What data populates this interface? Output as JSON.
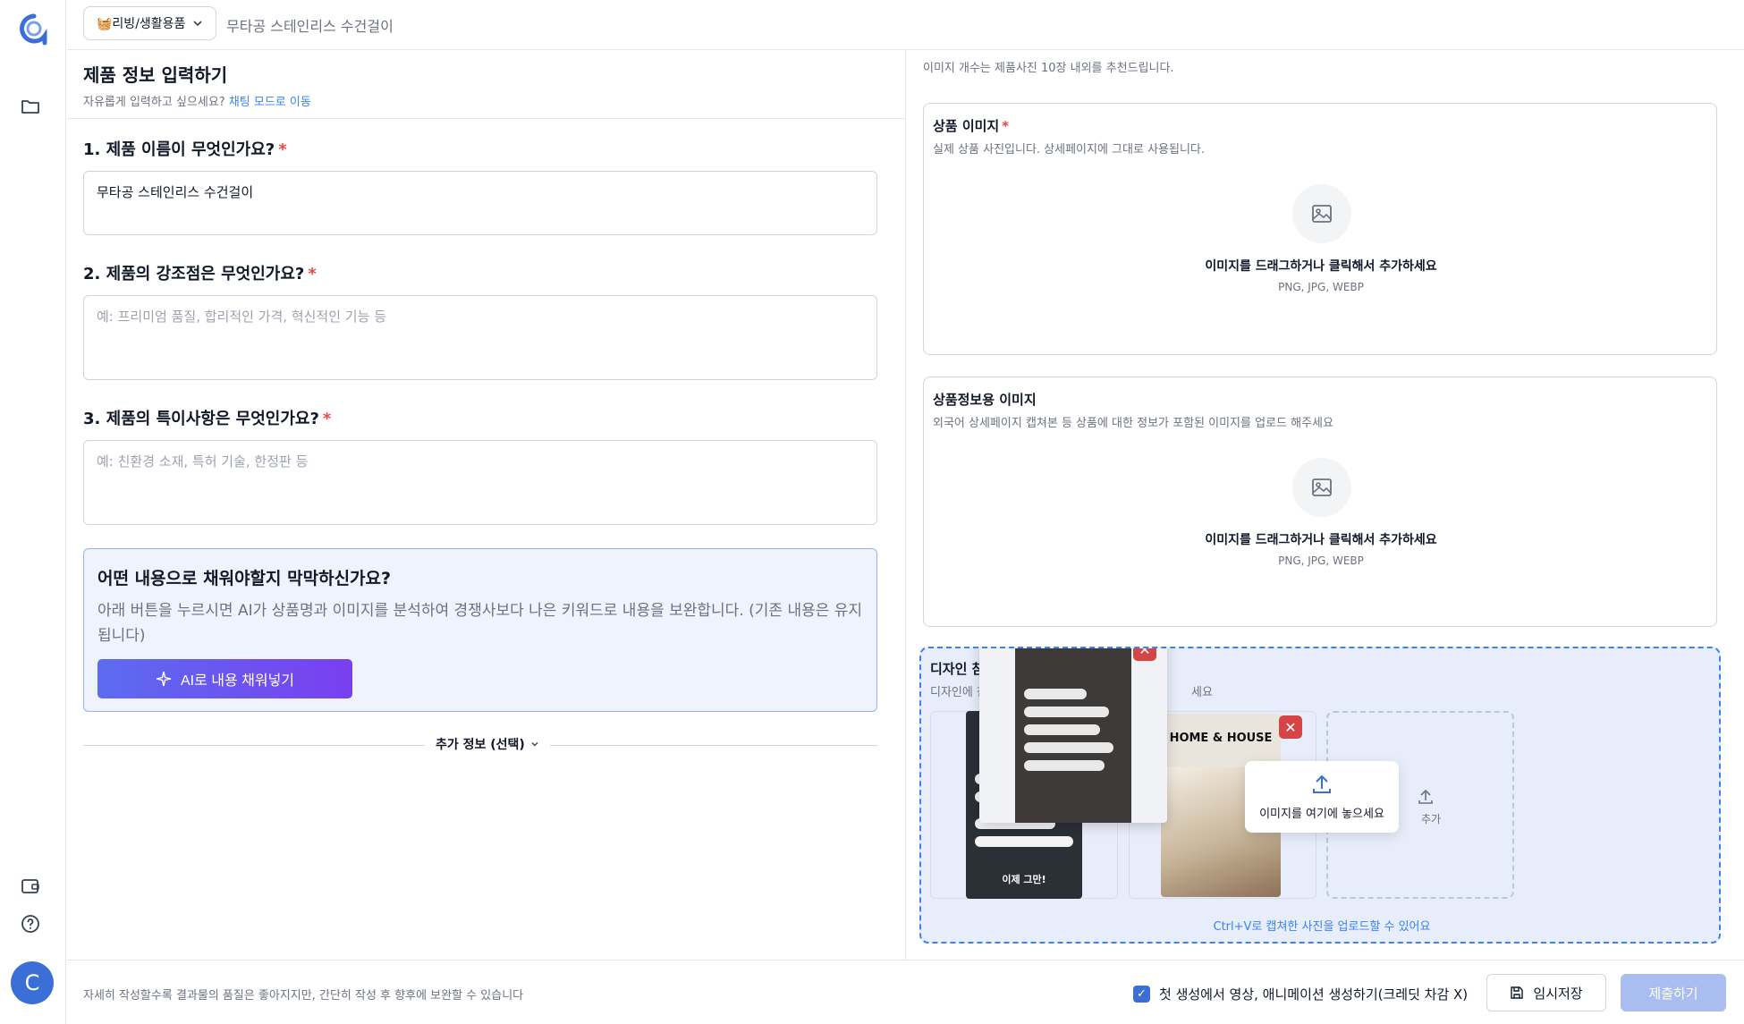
{
  "topbar": {
    "category_label": "🧺리빙/생활용품",
    "breadcrumb": "무타공 스테인리스 수건걸이"
  },
  "form": {
    "title": "제품 정보 입력하기",
    "subtitle": "자유롭게 입력하고 싶으세요?",
    "chat_link": "채팅 모드로 이동",
    "q1": {
      "label": "1. 제품 이름이 무엇인가요?",
      "required": "*",
      "value": "무타공 스테인리스 수건걸이"
    },
    "q2": {
      "label": "2. 제품의 강조점은 무엇인가요?",
      "required": "*",
      "placeholder": "예: 프리미엄 품질, 합리적인 가격, 혁신적인 기능 등"
    },
    "q3": {
      "label": "3. 제품의 특이사항은 무엇인가요?",
      "required": "*",
      "placeholder": "예: 친환경 소재, 특허 기술, 한정판 등"
    },
    "ai_card": {
      "title": "어떤 내용으로 채워야할지 막막하신가요?",
      "description": "아래 버튼을 누르시면 AI가 상품명과 이미지를 분석하여 경쟁사보다 나은 키워드로 내용을 보완합니다. (기존 내용은 유지됩니다)",
      "button": "AI로 내용 채워넣기"
    },
    "extra_info": "추가 정보 (선택)"
  },
  "images": {
    "hint": "이미지 개수는 제품사진 10장 내외를 추천드립니다.",
    "product": {
      "title": "상품 이미지",
      "required": "*",
      "description": "실제 상품 사진입니다. 상세페이지에 그대로 사용됩니다.",
      "drop_text": "이미지를 드래그하거나 클릭해서 추가하세요",
      "formats": "PNG, JPG, WEBP"
    },
    "info": {
      "title": "상품정보용 이미지",
      "description": "외국어 상세페이지 캡쳐본 등 상품에 대한 정보가 포함된 이미지를 업로드 해주세요",
      "drop_text": "이미지를 드래그하거나 클릭해서 추가하세요",
      "formats": "PNG, JPG, WEBP"
    },
    "design": {
      "title": "디자인 참고용 이",
      "description": "디자인에 참고할",
      "description_tail": "세요",
      "thumb_brand": "HOME & HOUSE",
      "thumb1_caption": "이제 그만!",
      "drop_here": "이미지를 여기에 놓으세요",
      "add_label": "추가",
      "footer": "Ctrl+V로 캡쳐한 사진을 업로드할 수 있어요"
    }
  },
  "bottom": {
    "note": "자세히 작성할수록 결과물의 품질은 좋아지지만, 간단히 작성 후 향후에 보완할 수 있습니다",
    "checkbox_label": "첫 생성에서 영상, 애니메이션 생성하기(크레딧 차감 X)",
    "save": "임시저장",
    "submit": "제출하기"
  },
  "user": {
    "avatar_initial": "C"
  },
  "colors": {
    "accent": "#3b6fd8",
    "required": "#ef4444",
    "link": "#3b82f6",
    "submit_disabled": "#a9bdf0"
  }
}
